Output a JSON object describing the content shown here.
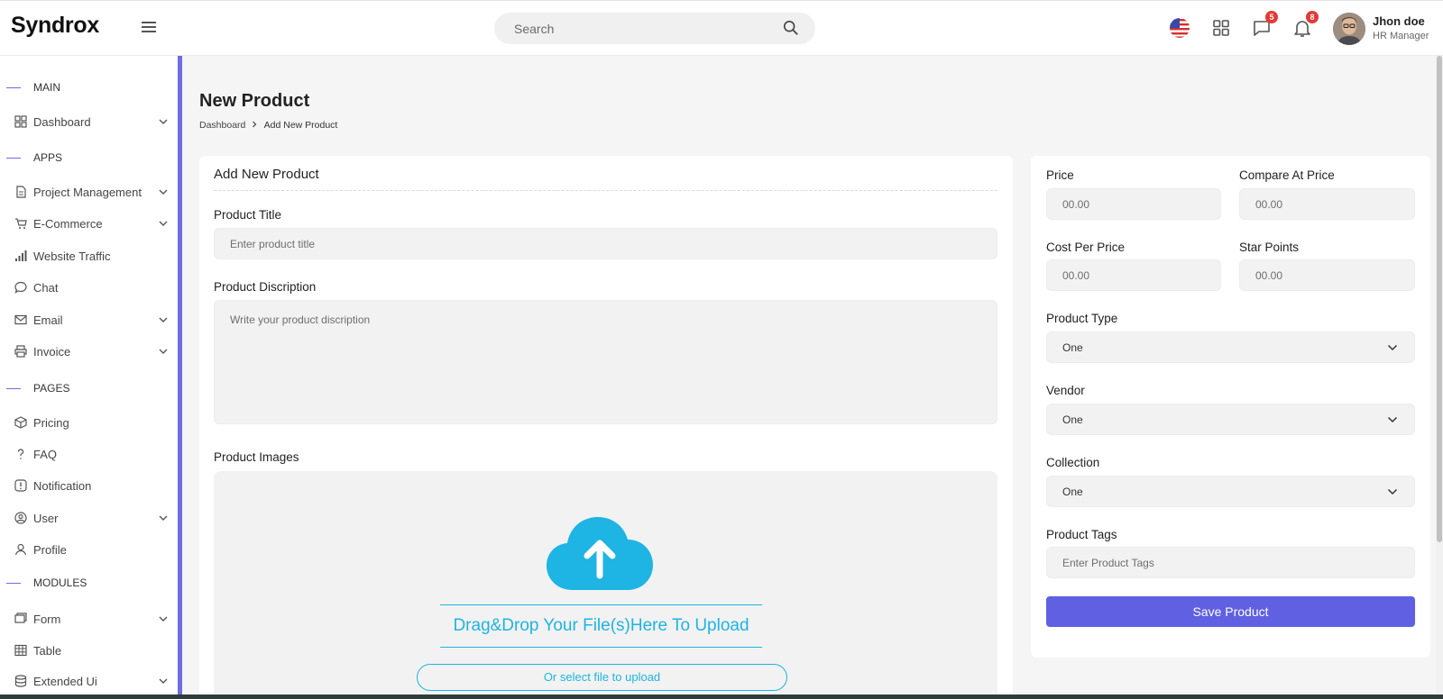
{
  "header": {
    "logo": "Syndrox",
    "search_placeholder": "Search",
    "messages_badge": "5",
    "notifications_badge": "8",
    "user_name": "Jhon doe",
    "user_role": "HR Manager"
  },
  "sidebar": {
    "sections": {
      "main": "MAIN",
      "apps": "APPS",
      "pages": "PAGES",
      "modules": "MODULES"
    },
    "items": [
      {
        "label": "Dashboard",
        "icon": "grid-icon",
        "has_submenu": true
      },
      {
        "label": "Project Management",
        "icon": "document-icon",
        "has_submenu": true
      },
      {
        "label": "E-Commerce",
        "icon": "cart-icon",
        "has_submenu": true
      },
      {
        "label": "Website Traffic",
        "icon": "bar-chart-icon",
        "has_submenu": false
      },
      {
        "label": "Chat",
        "icon": "chat-icon",
        "has_submenu": false
      },
      {
        "label": "Email",
        "icon": "mail-icon",
        "has_submenu": true
      },
      {
        "label": "Invoice",
        "icon": "printer-icon",
        "has_submenu": true
      },
      {
        "label": "Pricing",
        "icon": "box-icon",
        "has_submenu": false
      },
      {
        "label": "FAQ",
        "icon": "question-icon",
        "has_submenu": false
      },
      {
        "label": "Notification",
        "icon": "alert-icon",
        "has_submenu": false
      },
      {
        "label": "User",
        "icon": "user-circle-icon",
        "has_submenu": true
      },
      {
        "label": "Profile",
        "icon": "person-icon",
        "has_submenu": false
      },
      {
        "label": "Form",
        "icon": "form-icon",
        "has_submenu": true
      },
      {
        "label": "Table",
        "icon": "table-icon",
        "has_submenu": false
      },
      {
        "label": "Extended Ui",
        "icon": "database-icon",
        "has_submenu": true
      }
    ]
  },
  "page": {
    "title": "New Product",
    "breadcrumb": [
      "Dashboard",
      "Add New Product"
    ]
  },
  "product_form": {
    "card_title": "Add New Product",
    "title_label": "Product Title",
    "title_placeholder": "Enter product title",
    "description_label": "Product Discription",
    "description_placeholder": "Write your product discription",
    "images_label": "Product Images",
    "upload_text": "Drag&Drop Your File(s)Here To Upload",
    "select_file_label": "Or select file to upload"
  },
  "pricing_form": {
    "price_label": "Price",
    "price_placeholder": "00.00",
    "compare_label": "Compare At Price",
    "compare_placeholder": "00.00",
    "cost_label": "Cost Per Price",
    "cost_placeholder": "00.00",
    "star_label": "Star Points",
    "star_placeholder": "00.00",
    "type_label": "Product Type",
    "type_value": "One",
    "vendor_label": "Vendor",
    "vendor_value": "One",
    "collection_label": "Collection",
    "collection_value": "One",
    "tags_label": "Product Tags",
    "tags_placeholder": "Enter Product Tags",
    "save_label": "Save Product"
  },
  "colors": {
    "accent": "#6060e2",
    "upload": "#1eb4e4",
    "badge": "#e53935"
  }
}
